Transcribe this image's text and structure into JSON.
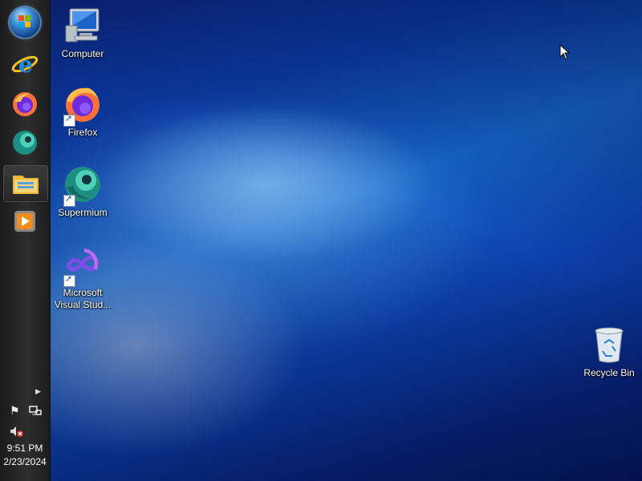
{
  "desktop": {
    "icons": [
      {
        "label": "Computer",
        "icon": "computer-icon"
      },
      {
        "label": "Firefox",
        "icon": "firefox-icon"
      },
      {
        "label": "Supermium",
        "icon": "supermium-icon"
      },
      {
        "label": "Microsoft Visual Stud...",
        "icon": "visual-studio-icon"
      },
      {
        "label": "Recycle Bin",
        "icon": "recycle-bin-icon"
      }
    ]
  },
  "taskbar": {
    "pinned": [
      {
        "name": "start-button",
        "icon": "windows-orb-icon"
      },
      {
        "name": "internet-explorer",
        "icon": "internet-explorer-icon"
      },
      {
        "name": "firefox",
        "icon": "firefox-icon"
      },
      {
        "name": "supermium",
        "icon": "supermium-icon"
      },
      {
        "name": "file-explorer",
        "icon": "folder-icon"
      },
      {
        "name": "media-player",
        "icon": "media-player-icon"
      }
    ],
    "tray": {
      "time": "9:51 PM",
      "date": "2/23/2024"
    }
  },
  "colors": {
    "taskbar_bg": "#262626",
    "desktop_accent": "#1565c8"
  }
}
